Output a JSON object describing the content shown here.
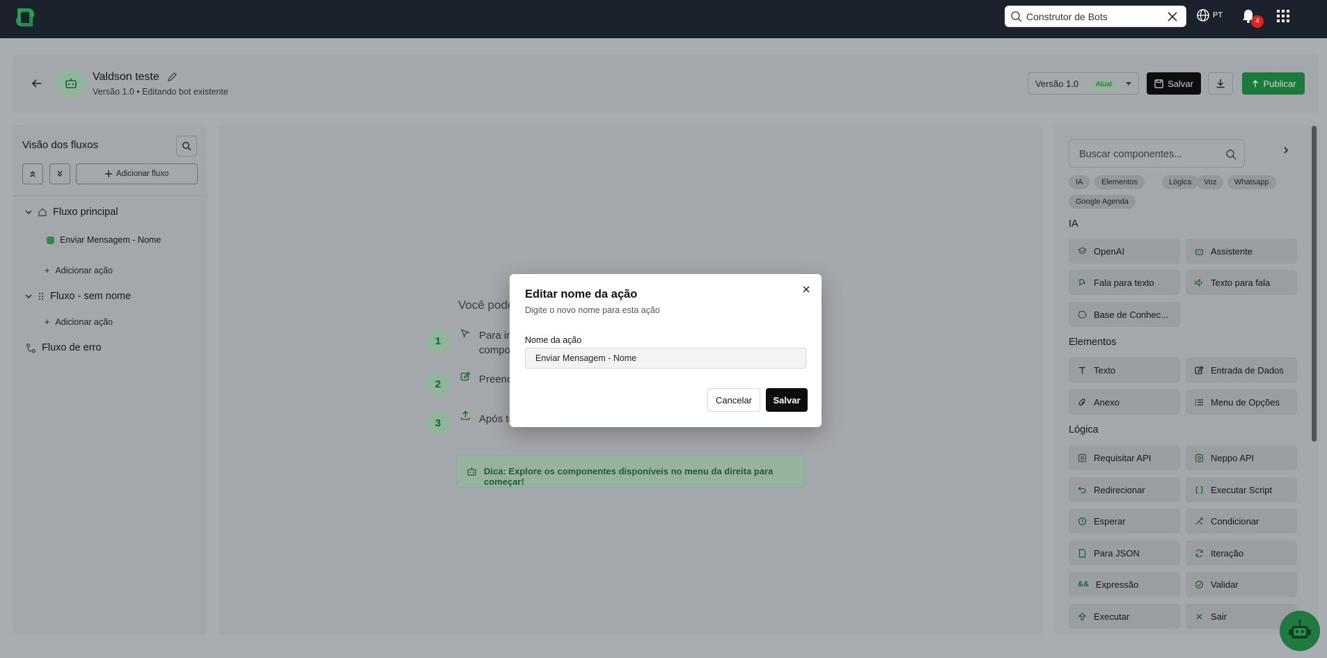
{
  "topbar": {
    "search_value": "Construtor de Bots",
    "language": "PT",
    "notification_count": "4"
  },
  "header": {
    "bot_name": "Valdson teste",
    "subtitle": "Versão 1.0 • Editando bot existente",
    "version_label": "Versão 1.0",
    "version_badge": "Atual",
    "save_label": "Salvar",
    "publish_label": "Publicar"
  },
  "left_panel": {
    "title": "Visão dos fluxos",
    "add_flow_label": "Adicionar fluxo",
    "flows": {
      "main": "Fluxo principal",
      "main_action": "Enviar Mensagem - Nome",
      "add_action": "Adicionar ação",
      "unnamed": "Fluxo - sem nome",
      "error": "Fluxo de erro"
    }
  },
  "canvas": {
    "heading": "Você pode",
    "steps": [
      {
        "num": "1",
        "text_line1": "Para in",
        "text_line2": "compo"
      },
      {
        "num": "2",
        "text": "Preenc"
      },
      {
        "num": "3",
        "text": "Após te"
      }
    ],
    "tip": "Dica: Explore os componentes disponíveis no menu da direita para começar!"
  },
  "right_panel": {
    "search_placeholder": "Buscar componentes...",
    "chips": [
      "IA",
      "Elementos",
      "Lógica",
      "Voz",
      "Whatsapp",
      "Google Agenda"
    ],
    "sections": {
      "ia": {
        "title": "IA",
        "items": [
          "OpenAI",
          "Assistente",
          "Fala para texto",
          "Texto para fala",
          "Base de Conhec..."
        ]
      },
      "elementos": {
        "title": "Elementos",
        "items": [
          "Texto",
          "Entrada de Dados",
          "Anexo",
          "Menu de Opções"
        ]
      },
      "logica": {
        "title": "Lógica",
        "items": [
          "Requisitar API",
          "Neppo API",
          "Redirecionar",
          "Executar Script",
          "Esperar",
          "Condicionar",
          "Para JSON",
          "Iteração",
          "Expressão",
          "Validar",
          "Executar",
          "Sair"
        ]
      }
    }
  },
  "modal": {
    "title": "Editar nome da ação",
    "subtitle": "Digite o novo nome para esta ação",
    "field_label": "Nome da ação",
    "field_value": "Enviar Mensagem - Nome",
    "cancel_label": "Cancelar",
    "save_label": "Salvar"
  },
  "colors": {
    "brand_green": "#22a04b",
    "topbar_bg": "#1b222c",
    "overlay_bg": "#a4a7ab",
    "badge_red": "#e02424"
  }
}
